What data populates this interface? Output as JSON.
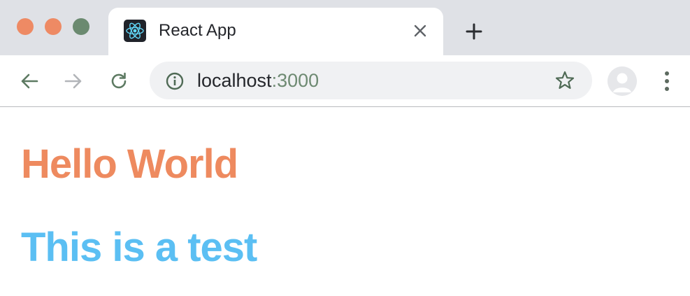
{
  "window_controls": {
    "close_color": "#ee8a64",
    "minimize_color": "#ee8a64",
    "maximize_color": "#6b8a70"
  },
  "tab": {
    "title": "React App",
    "favicon": "react-logo-icon"
  },
  "toolbar": {
    "back_icon": "arrow-left-icon",
    "forward_icon": "arrow-right-icon",
    "reload_icon": "reload-icon",
    "site_info_icon": "info-icon",
    "bookmark_icon": "star-icon",
    "profile_icon": "avatar-icon",
    "menu_icon": "kebab-menu-icon"
  },
  "address_bar": {
    "host": "localhost",
    "port": ":3000"
  },
  "page": {
    "heading_1": "Hello World",
    "heading_1_color": "#ee8a5f",
    "heading_2": "This is a test",
    "heading_2_color": "#5bbff3"
  }
}
